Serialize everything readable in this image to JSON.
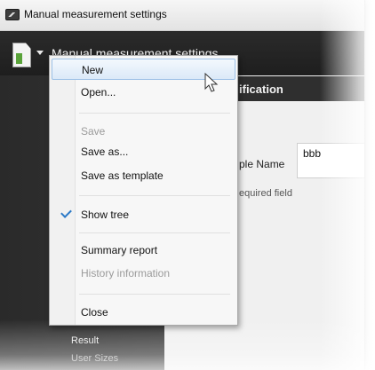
{
  "window": {
    "title": "Manual measurement settings"
  },
  "toolbar": {
    "title": "Manual measurement settings"
  },
  "section": {
    "title": "ification",
    "sample_label": "ple Name",
    "sample_value": "bbb",
    "required_note": "equired field"
  },
  "tree": {
    "items": [
      "Result",
      "User Sizes"
    ]
  },
  "menu": {
    "items": [
      {
        "label": "New",
        "state": "hover"
      },
      {
        "label": "Open..."
      },
      {
        "label": "Save",
        "state": "disabled"
      },
      {
        "label": "Save as..."
      },
      {
        "label": "Save as template"
      },
      {
        "label": "Show tree",
        "checked": true
      },
      {
        "label": "Summary report"
      },
      {
        "label": "History information",
        "state": "disabled"
      },
      {
        "label": "Close"
      }
    ]
  },
  "colors": {
    "dark_bg": "#3a3a3a",
    "menu_bg": "#f7f7f7",
    "hover_border": "#9cc0e6",
    "check_color": "#2b79c7"
  },
  "icons": {
    "app": "app-icon",
    "document": "document-icon",
    "dropdown": "chevron-down-icon",
    "check": "check-icon",
    "cursor": "mouse-cursor-icon"
  }
}
